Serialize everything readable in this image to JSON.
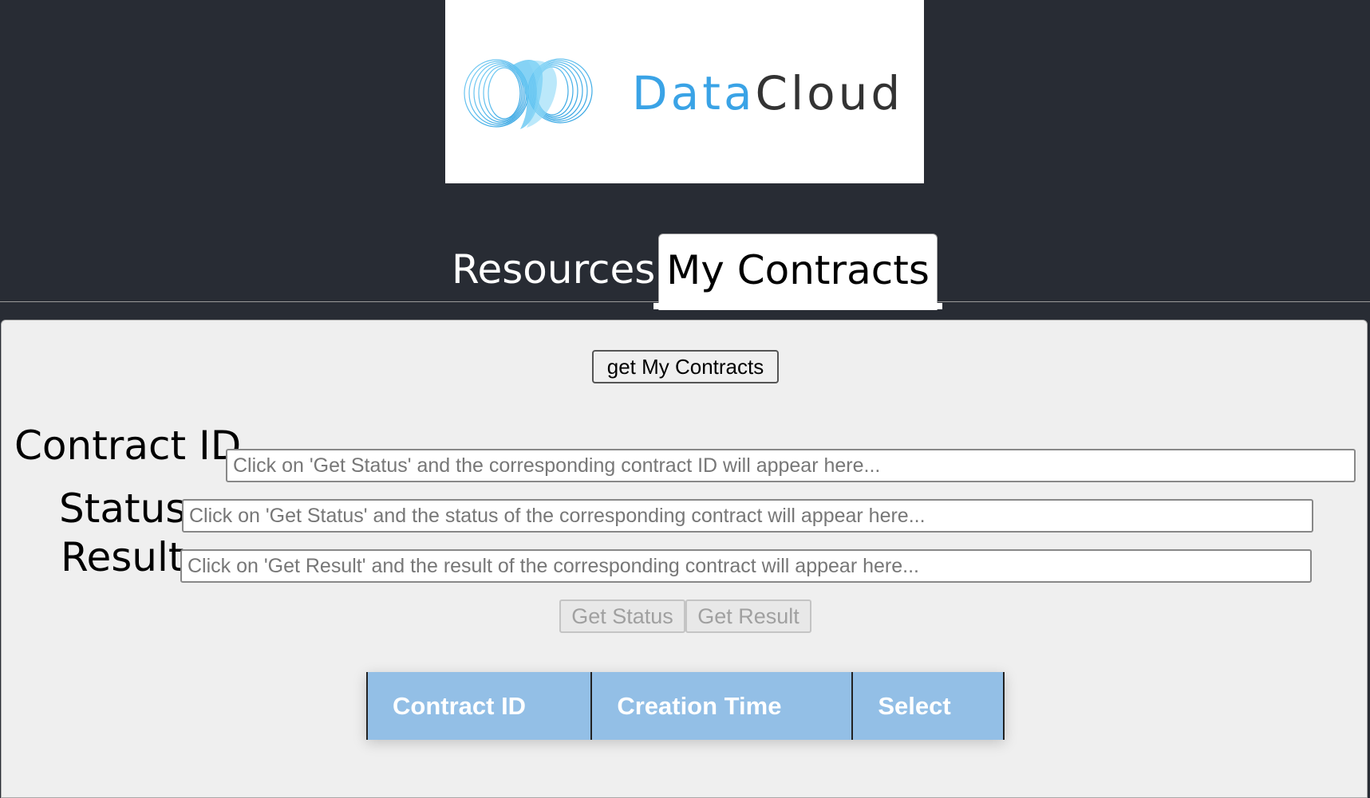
{
  "brand": {
    "logo_name": "datacloud-logo",
    "name_part1": "Data",
    "name_part2": "Cloud",
    "colors": {
      "accent": "#3aa3e6",
      "dark": "#333333"
    }
  },
  "tabs": [
    {
      "label": "Resources",
      "active": false
    },
    {
      "label": "My Contracts",
      "active": true
    }
  ],
  "main": {
    "get_contracts_label": "get My Contracts",
    "fields": {
      "contract_id": {
        "label": "Contract ID",
        "value": "",
        "placeholder": "Click on 'Get Status' and the corresponding contract ID will appear here..."
      },
      "status": {
        "label": "Status",
        "value": "",
        "placeholder": "Click on 'Get Status' and the status of the corresponding contract will appear here..."
      },
      "result": {
        "label": "Result",
        "value": "",
        "placeholder": "Click on 'Get Result' and the result of the corresponding contract will appear here..."
      }
    },
    "actions": {
      "get_status_label": "Get Status",
      "get_result_label": "Get Result",
      "disabled": true
    },
    "table": {
      "headers": [
        "Contract ID",
        "Creation Time",
        "Select"
      ],
      "rows": [],
      "header_color": "#93bfe6"
    }
  },
  "colors": {
    "background": "#282c34",
    "panel": "#efefef"
  }
}
